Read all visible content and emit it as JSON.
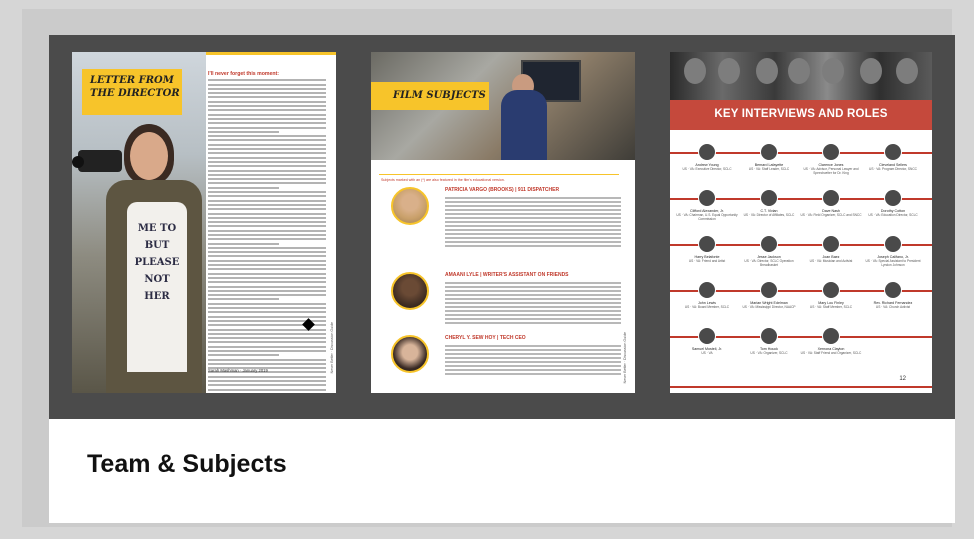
{
  "caption": "Team & Subjects",
  "page1": {
    "title_line1": "LETTER FROM",
    "title_line2": "THE DIRECTOR",
    "shirt_text": [
      "ME TO",
      "BUT",
      "PLEASE",
      "NOT",
      "HER"
    ],
    "lead": "I'll never forget this moment:",
    "signature": "Sarah Mashman · January 2019",
    "side_label": "Never Better · Discussion Guide"
  },
  "page2": {
    "title": "FILM SUBJECTS",
    "intro": "Subjects marked with an (*) are also featured in the film's educational version.",
    "subjects": [
      {
        "name": "PATRICIA VARGO (BROOKS) | 911 DISPATCHER"
      },
      {
        "name": "AMAANI LYLE | WRITER'S ASSISTANT ON FRIENDS"
      },
      {
        "name": "CHERYL Y. SEW HOY | TECH CEO"
      }
    ],
    "side_label": "Never Better · Discussion Guide"
  },
  "page3": {
    "title": "KEY INTERVIEWS AND ROLES",
    "page_number": "12",
    "rows": [
      [
        {
          "name": "Andrew Young",
          "role": "US · VA: Executive Director, SCLC"
        },
        {
          "name": "Bernard Lafayette",
          "role": "US · VA: Staff Leader, SCLC"
        },
        {
          "name": "Clarence Jones",
          "role": "US · VA: Advisor, Personal Lawyer and Speechwriter for Dr. King"
        },
        {
          "name": "Cleveland Sellers",
          "role": "US · VA: Program Director, SNCC"
        }
      ],
      [
        {
          "name": "Clifford Alexander, Jr.",
          "role": "US · VA: Chairman, U.S. Equal Opportunity Commission"
        },
        {
          "name": "C.T. Vivian",
          "role": "US · VA: Director of Affiliates, SCLC"
        },
        {
          "name": "Dave Nash",
          "role": "US · VA: Field Organizer, SCLC and SNCC"
        },
        {
          "name": "Dorothy Cotton",
          "role": "US · VA: Education Director, SCLC"
        }
      ],
      [
        {
          "name": "Harry Belafonte",
          "role": "US · VA: Friend and Artist"
        },
        {
          "name": "Jesse Jackson",
          "role": "US · VA: Director, SCLC Operation Breadbasket"
        },
        {
          "name": "Joan Baez",
          "role": "US · VA: Musician and Activist"
        },
        {
          "name": "Joseph Califano, Jr.",
          "role": "US · VA: Special Assistant to President Lyndon Johnson"
        }
      ],
      [
        {
          "name": "John Lewis",
          "role": "US · VA: Board Member, SCLC"
        },
        {
          "name": "Marian Wright Edelman",
          "role": "US · VA: Mississippi Director, NAACP"
        },
        {
          "name": "Mary Lou Finley",
          "role": "US · VA: Staff Member, SCLC"
        },
        {
          "name": "Rev. Richard Fernandez",
          "role": "US · VA: Church Activist"
        }
      ],
      [
        {
          "name": "Samuel Mosteli, Jr.",
          "role": "US · VA"
        },
        {
          "name": "Tom Houck",
          "role": "US · VA: Organizer, SCLC"
        },
        {
          "name": "Xernona Clayton",
          "role": "US · VA: Staff Friend and Organizer, SCLC"
        }
      ]
    ]
  }
}
